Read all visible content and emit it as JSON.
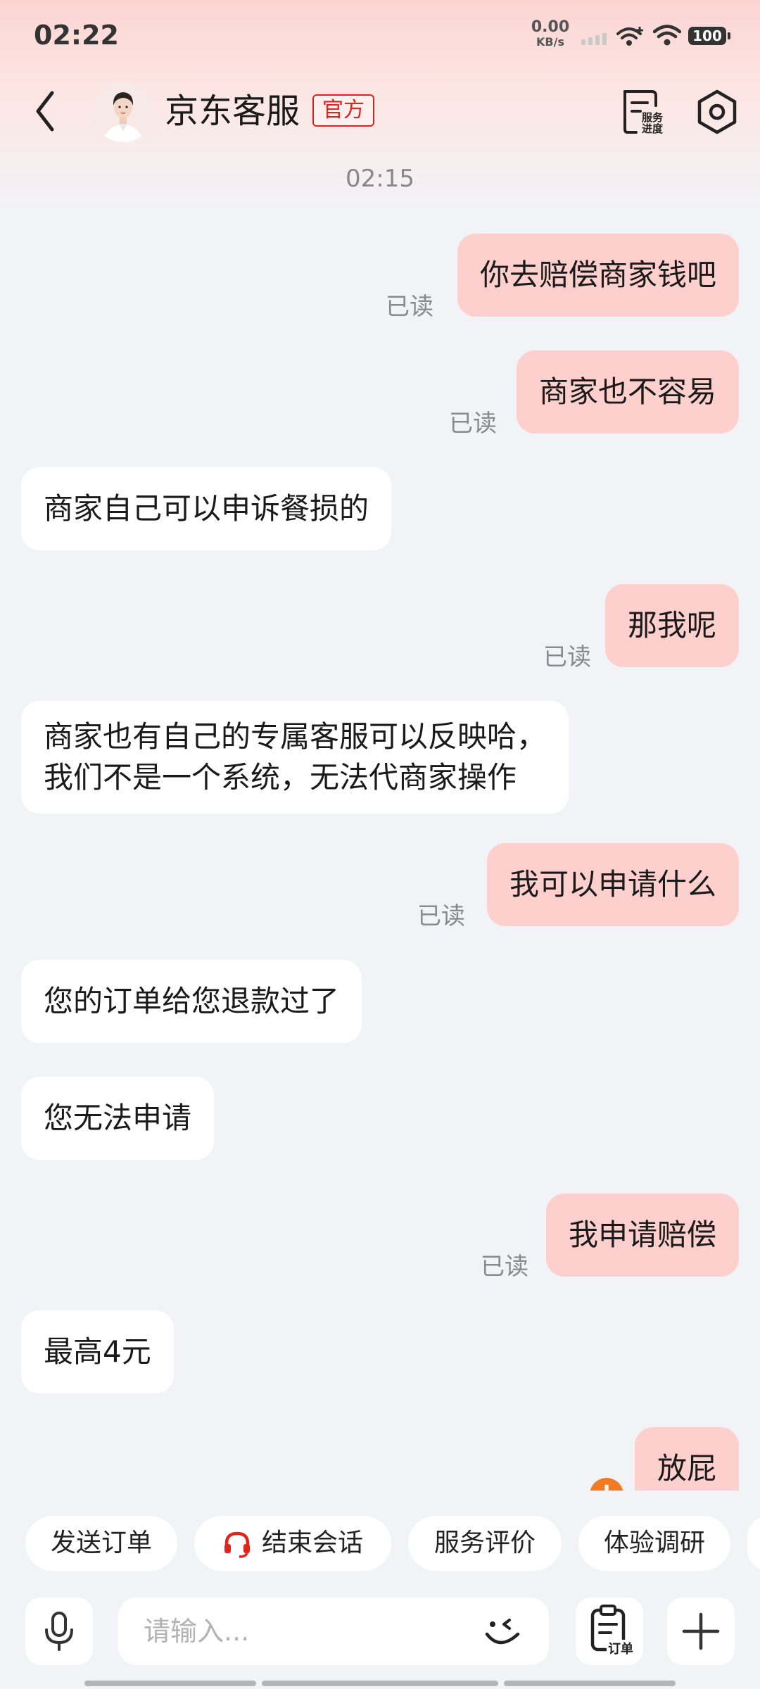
{
  "status_bar": {
    "time": "02:22",
    "net_speed_value": "0.00",
    "net_speed_unit": "KB/s",
    "battery": "100"
  },
  "header": {
    "title": "京东客服",
    "official_tag": "官方",
    "service_progress_label_1": "服务",
    "service_progress_label_2": "进度"
  },
  "chat": {
    "timestamp": "02:15",
    "read_label": "已读",
    "messages": [
      {
        "from": "me",
        "text": "你去赔偿商家钱吧",
        "read": true
      },
      {
        "from": "me",
        "text": "商家也不容易",
        "read": true
      },
      {
        "from": "agent",
        "text": "商家自己可以申诉餐损的"
      },
      {
        "from": "me",
        "text": "那我呢",
        "read": true
      },
      {
        "from": "agent",
        "lines": [
          "商家也有自己的专属客服可以反映哈，",
          "我们不是一个系统，无法代商家操作"
        ]
      },
      {
        "from": "me",
        "text": "我可以申请什么",
        "read": true
      },
      {
        "from": "agent",
        "text": "您的订单给您退款过了"
      },
      {
        "from": "agent",
        "text": "您无法申请"
      },
      {
        "from": "me",
        "text": "我申请赔偿",
        "read": true
      },
      {
        "from": "agent",
        "text": "最高4元"
      },
      {
        "from": "me",
        "text": "放屁",
        "read": false
      }
    ]
  },
  "quick_actions": [
    {
      "label": "发送订单"
    },
    {
      "label": "结束会话",
      "icon": "headset-icon"
    },
    {
      "label": "服务评价"
    },
    {
      "label": "体验调研"
    }
  ],
  "input": {
    "placeholder": "请输入...",
    "order_label": "订单"
  },
  "colors": {
    "accent": "#e2231a",
    "sent_bubble": "#fdd0cd",
    "received_bubble": "#ffffff",
    "background": "#f2f3f7",
    "badge": "#f07b22"
  }
}
